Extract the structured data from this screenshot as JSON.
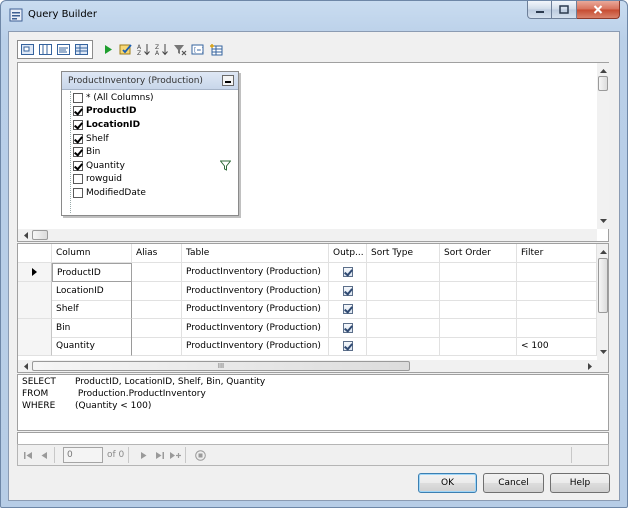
{
  "window": {
    "title": "Query Builder",
    "controls": {
      "minimize": "minimize",
      "maximize": "maximize",
      "close": "close"
    }
  },
  "toolbar": {
    "pane_toggles": [
      "diagram-pane-icon",
      "criteria-pane-icon",
      "sql-pane-icon",
      "results-pane-icon"
    ],
    "actions": [
      "run-icon",
      "verify-sql-icon",
      "sort-ascending-icon",
      "sort-descending-icon",
      "remove-filter-icon",
      "group-by-icon",
      "add-table-icon"
    ]
  },
  "diagram": {
    "table": {
      "title": "ProductInventory (Production)",
      "columns": [
        {
          "label": "* (All Columns)",
          "checked": false,
          "bold": false,
          "filter": false
        },
        {
          "label": "ProductID",
          "checked": true,
          "bold": true,
          "filter": false
        },
        {
          "label": "LocationID",
          "checked": true,
          "bold": true,
          "filter": false
        },
        {
          "label": "Shelf",
          "checked": true,
          "bold": false,
          "filter": false
        },
        {
          "label": "Bin",
          "checked": true,
          "bold": false,
          "filter": false
        },
        {
          "label": "Quantity",
          "checked": true,
          "bold": false,
          "filter": true
        },
        {
          "label": "rowguid",
          "checked": false,
          "bold": false,
          "filter": false
        },
        {
          "label": "ModifiedDate",
          "checked": false,
          "bold": false,
          "filter": false
        }
      ]
    }
  },
  "criteria": {
    "headers": {
      "column": "Column",
      "alias": "Alias",
      "table": "Table",
      "output": "Outp...",
      "sort_type": "Sort Type",
      "sort_order": "Sort Order",
      "filter": "Filter"
    },
    "rows": [
      {
        "column": "ProductID",
        "alias": "",
        "table": "ProductInventory (Production)",
        "output": true,
        "sort_type": "",
        "sort_order": "",
        "filter": ""
      },
      {
        "column": "LocationID",
        "alias": "",
        "table": "ProductInventory (Production)",
        "output": true,
        "sort_type": "",
        "sort_order": "",
        "filter": ""
      },
      {
        "column": "Shelf",
        "alias": "",
        "table": "ProductInventory (Production)",
        "output": true,
        "sort_type": "",
        "sort_order": "",
        "filter": ""
      },
      {
        "column": "Bin",
        "alias": "",
        "table": "ProductInventory (Production)",
        "output": true,
        "sort_type": "",
        "sort_order": "",
        "filter": ""
      },
      {
        "column": "Quantity",
        "alias": "",
        "table": "ProductInventory (Production)",
        "output": true,
        "sort_type": "",
        "sort_order": "",
        "filter": "< 100"
      }
    ],
    "hscroll_grip": "III"
  },
  "sql": {
    "lines": [
      {
        "keyword": "SELECT",
        "text": "ProductID, LocationID, Shelf, Bin, Quantity"
      },
      {
        "keyword": "FROM",
        "text": " Production.ProductInventory"
      },
      {
        "keyword": "WHERE",
        "text": "(Quantity < 100)"
      }
    ]
  },
  "navigator": {
    "record_value": "0",
    "of_text": "of 0"
  },
  "buttons": {
    "ok": "OK",
    "cancel": "Cancel",
    "help": "Help"
  },
  "colors": {
    "accent": "#3c7fb1",
    "close_red": "#c64a2f",
    "run_green": "#1e9e2e"
  }
}
